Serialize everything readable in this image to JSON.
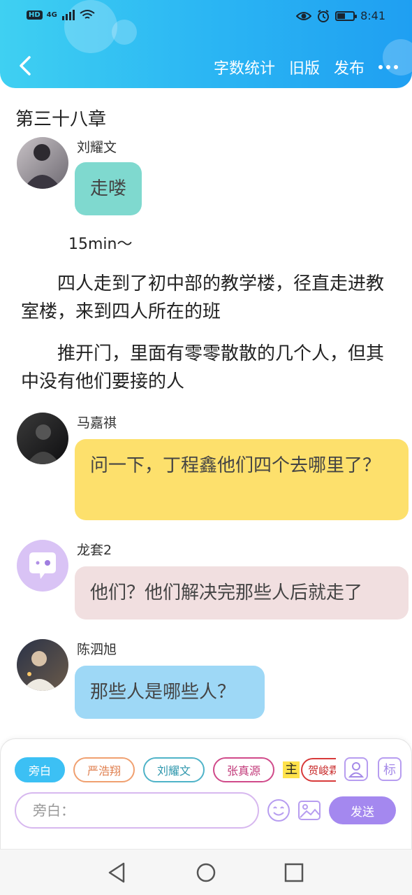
{
  "status_bar": {
    "left_badges": [
      "HD",
      "4G"
    ],
    "time": "8:41",
    "battery_level": 0.5
  },
  "toolbar": {
    "back_icon": "chevron-left-icon",
    "word_count_label": "字数统计",
    "old_version_label": "旧版",
    "publish_label": "发布",
    "more_icon": "more-dots-icon"
  },
  "chapter": {
    "title": "第三十八章"
  },
  "messages": [
    {
      "type": "dialogue",
      "speaker": "刘耀文",
      "text": "走喽",
      "bubble_color": "#7fd9cf"
    },
    {
      "type": "narration",
      "text": "15min～"
    },
    {
      "type": "narration",
      "text": "　　四人走到了初中部的教学楼，径直走进教室楼，来到四人所在的班"
    },
    {
      "type": "narration",
      "text": "　　推开门，里面有零零散散的几个人，但其中没有他们要接的人"
    },
    {
      "type": "dialogue",
      "speaker": "马嘉祺",
      "text": "问一下，丁程鑫他们四个去哪里了？",
      "bubble_color": "#fde06c"
    },
    {
      "type": "dialogue",
      "speaker": "龙套2",
      "text": "他们？他们解决完那些人后就走了",
      "bubble_color": "#f1dfe0"
    },
    {
      "type": "dialogue",
      "speaker": "陈泗旭",
      "text": "那些人是哪些人？",
      "bubble_color": "#9ed8f6"
    }
  ],
  "roles": [
    {
      "label": "旁白",
      "active": true,
      "color": "#3cc0f4"
    },
    {
      "label": "严浩翔",
      "active": false,
      "color": "#f0a070"
    },
    {
      "label": "刘耀文",
      "active": false,
      "color": "#4fb3c8"
    },
    {
      "label": "张真源",
      "active": false,
      "color": "#d04a8a"
    },
    {
      "label": "贺峻霖",
      "active": false,
      "color": "#d83a3a",
      "tag": "主"
    }
  ],
  "composer": {
    "placeholder": "旁白：",
    "send_label": "发送",
    "mark_label": "标"
  },
  "colors": {
    "header_gradient_start": "#3fd0f2",
    "header_gradient_end": "#1f9ff2",
    "accent_purple": "#a488ef"
  }
}
